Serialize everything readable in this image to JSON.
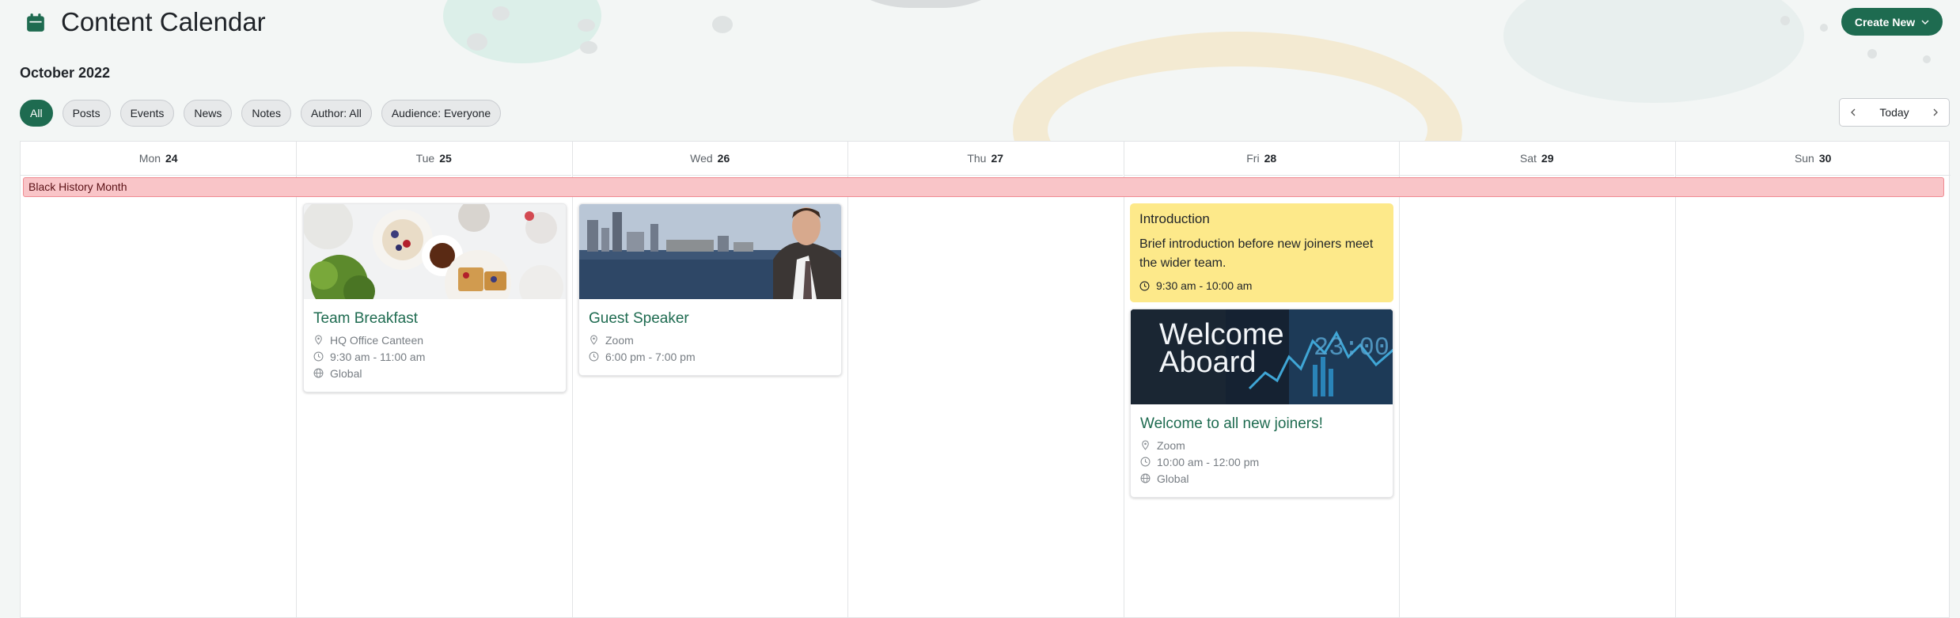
{
  "header": {
    "title": "Content Calendar",
    "create_button": "Create New"
  },
  "month": "October 2022",
  "filters": [
    "All",
    "Posts",
    "Events",
    "News",
    "Notes",
    "Author: All",
    "Audience: Everyone"
  ],
  "active_filter": "All",
  "pager": {
    "today_label": "Today"
  },
  "days": [
    {
      "dow": "Mon",
      "date": "24"
    },
    {
      "dow": "Tue",
      "date": "25"
    },
    {
      "dow": "Wed",
      "date": "26"
    },
    {
      "dow": "Thu",
      "date": "27"
    },
    {
      "dow": "Fri",
      "date": "28"
    },
    {
      "dow": "Sat",
      "date": "29"
    },
    {
      "dow": "Sun",
      "date": "30"
    }
  ],
  "banner": {
    "label": "Black History Month",
    "color": "#f9c5c8"
  },
  "events": {
    "team_breakfast": {
      "title": "Team Breakfast",
      "location": "HQ Office Canteen",
      "time": "9:30 am - 11:00 am",
      "audience": "Global"
    },
    "guest_speaker": {
      "title": "Guest Speaker",
      "location": "Zoom",
      "time": "6:00 pm - 7:00 pm"
    },
    "introduction": {
      "title": "Introduction",
      "body": "Brief introduction before new joiners meet the wider team.",
      "time": "9:30 am - 10:00 am"
    },
    "welcome": {
      "image_text_1": "Welcome",
      "image_text_2": "Aboard",
      "title": "Welcome to all new joiners!",
      "location": "Zoom",
      "time": "10:00 am - 12:00 pm",
      "audience": "Global"
    }
  },
  "colors": {
    "accent": "#1e6b50",
    "note": "#fde98a"
  }
}
